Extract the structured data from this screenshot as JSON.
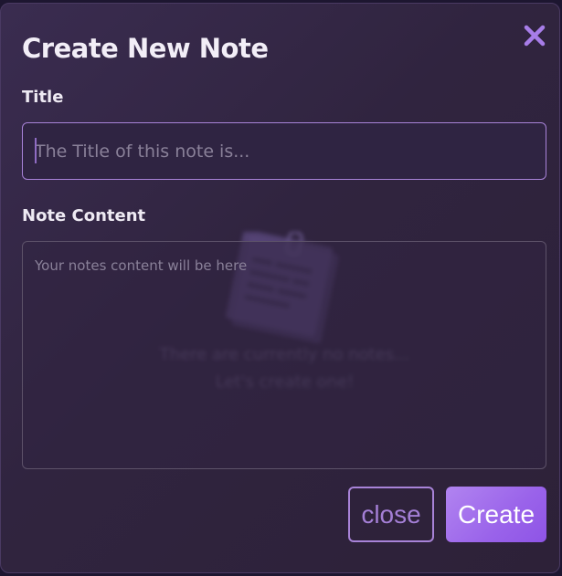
{
  "modal": {
    "title": "Create New Note",
    "close_icon": "close-x-icon"
  },
  "form": {
    "title_label": "Title",
    "title_placeholder": "The Title of this note is...",
    "title_value": "",
    "content_label": "Note Content",
    "content_placeholder": "Your notes content will be here",
    "content_value": ""
  },
  "background_empty_state": {
    "icon": "notes-clipboard-icon",
    "line1": "There are currently no notes...",
    "line2": "Let's create one!"
  },
  "buttons": {
    "close_label": "close",
    "create_label": "Create"
  },
  "colors": {
    "accent": "#a883d8",
    "close_x": "#a77de8",
    "create_button": "#9a63ea",
    "background": "#30243f"
  }
}
